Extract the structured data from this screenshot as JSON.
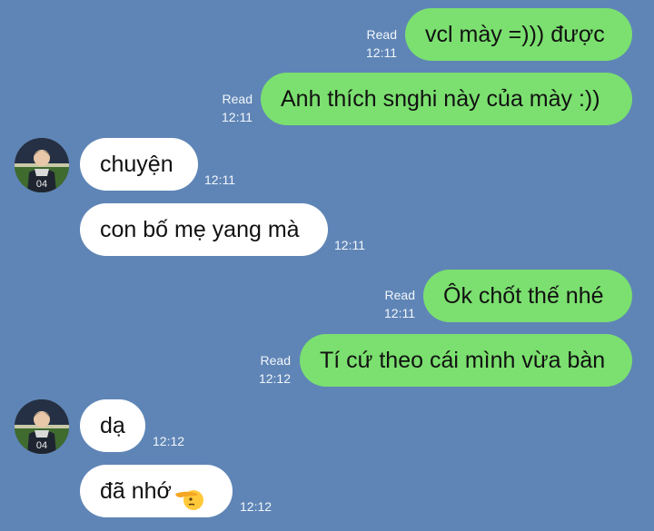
{
  "messages": [
    {
      "direction": "out",
      "text": "vcl mày =))) được",
      "read_label": "Read",
      "time": "12:11"
    },
    {
      "direction": "out",
      "text": "Anh thích snghi này của mày :))",
      "read_label": "Read",
      "time": "12:11"
    },
    {
      "direction": "in",
      "text": "chuyện",
      "time": "12:11",
      "has_avatar": true
    },
    {
      "direction": "in",
      "text": "con bố mẹ yang mà",
      "time": "12:11"
    },
    {
      "direction": "out",
      "text": "Ôk chốt thế nhé",
      "read_label": "Read",
      "time": "12:11"
    },
    {
      "direction": "out",
      "text": "Tí cứ theo cái mình vừa bàn",
      "read_label": "Read",
      "time": "12:12"
    },
    {
      "direction": "in",
      "text": "dạ",
      "time": "12:12",
      "has_avatar": true
    },
    {
      "direction": "in",
      "text": "đã nhớ",
      "time": "12:12",
      "emoji": "saluting-face-icon"
    }
  ],
  "colors": {
    "background": "#5f85b6",
    "outgoing_bubble": "#7be06f",
    "incoming_bubble": "#ffffff",
    "meta_text": "#f2f6fb"
  }
}
